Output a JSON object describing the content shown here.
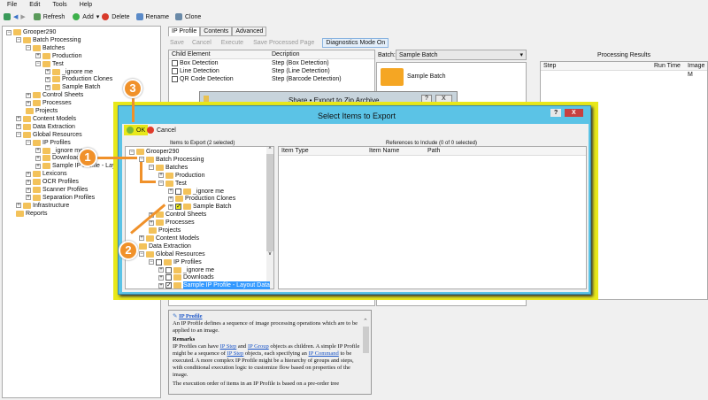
{
  "menu": [
    "File",
    "Edit",
    "Tools",
    "Help"
  ],
  "toolbar": {
    "refresh": "Refresh",
    "add": "Add",
    "delete": "Delete",
    "rename": "Rename",
    "clone": "Clone"
  },
  "tree": [
    [
      0,
      "Grooper290",
      "-"
    ],
    [
      1,
      "Batch Processing",
      "-"
    ],
    [
      2,
      "Batches",
      "-"
    ],
    [
      3,
      "Production",
      "+"
    ],
    [
      3,
      "Test",
      "-"
    ],
    [
      4,
      "_ignore me",
      "+"
    ],
    [
      4,
      "Production Clones",
      "+"
    ],
    [
      4,
      "Sample Batch",
      "+"
    ],
    [
      2,
      "Control Sheets",
      "+"
    ],
    [
      2,
      "Processes",
      "+"
    ],
    [
      2,
      "Projects",
      ""
    ],
    [
      1,
      "Content Models",
      "+"
    ],
    [
      1,
      "Data Extraction",
      "+"
    ],
    [
      1,
      "Global Resources",
      "-"
    ],
    [
      2,
      "IP Profiles",
      "-"
    ],
    [
      3,
      "_ignore me",
      "+"
    ],
    [
      3,
      "Downloads",
      "+"
    ],
    [
      3,
      "Sample IP Profile - Layout Data",
      "+"
    ],
    [
      2,
      "Lexicons",
      "+"
    ],
    [
      2,
      "OCR Profiles",
      "+"
    ],
    [
      2,
      "Scanner Profiles",
      "+"
    ],
    [
      2,
      "Separation Profiles",
      "+"
    ],
    [
      1,
      "Infrastructure",
      "+"
    ],
    [
      1,
      "Reports",
      ""
    ]
  ],
  "tabs": [
    "IP Profile",
    "Contents",
    "Advanced"
  ],
  "actions": {
    "save": "Save",
    "cancel": "Cancel",
    "execute": "Execute",
    "save_page": "Save Processed Page",
    "diag": "Diagnostics Mode On"
  },
  "grid": {
    "cols": [
      "Child Element",
      "Decription"
    ],
    "rows": [
      [
        "Box Detection",
        "Step (Box Detection)"
      ],
      [
        "Line Detection",
        "Step (Line Detection)"
      ],
      [
        "QR Code Detection",
        "Step (Barcode Detection)"
      ]
    ]
  },
  "batch": {
    "label": "Batch:",
    "value": "Sample Batch",
    "item": "Sample Batch"
  },
  "results": {
    "title": "Processing Results",
    "cols": [
      "Step",
      "Run Time",
      "Image M"
    ]
  },
  "help": {
    "title": "IP Profile",
    "p1": "An IP Profile defines a sequence of image processing operations which are to be applied to an image.",
    "remarks": "Remarks",
    "p2a": "IP Profiles can have ",
    "l1": "IP Step",
    "p2b": " and ",
    "l2": "IP Group",
    "p2c": " objects as children. A simple IP Profile might be a sequence of ",
    "l3": "IP Step",
    "p2d": " objects, each specifying an ",
    "l4": "IP Command",
    "p2e": " to be executed. A more complex IP Profile might be a hierarchy of groups and steps, with conditional execution logic to customize flow based on properties of the image.",
    "p3": "The execution order of items in an IP Profile is based on a pre-order tree"
  },
  "share": {
    "title": "Share • Export to Zip Archive",
    "help": "?",
    "close": "X"
  },
  "dialog": {
    "title": "Select Items to Export",
    "help": "?",
    "close": "X",
    "ok": "OK",
    "cancel": "Cancel",
    "left_title": "Items to Export (2 selected)",
    "right_title": "References to Include (0 of 0 selected)",
    "cols": [
      "Item Type",
      "Item Name",
      "Path"
    ],
    "tree": [
      [
        0,
        "Grooper290",
        "-",
        ""
      ],
      [
        1,
        "Batch Processing",
        "-",
        ""
      ],
      [
        2,
        "Batches",
        "-",
        ""
      ],
      [
        3,
        "Production",
        "+",
        ""
      ],
      [
        3,
        "Test",
        "-",
        ""
      ],
      [
        4,
        "_ignore me",
        "+",
        "no"
      ],
      [
        4,
        "Production Clones",
        "+",
        ""
      ],
      [
        4,
        "Sample Batch",
        "+",
        "yes"
      ],
      [
        2,
        "Control Sheets",
        "+",
        ""
      ],
      [
        2,
        "Processes",
        "+",
        ""
      ],
      [
        2,
        "Projects",
        "",
        ""
      ],
      [
        1,
        "Content Models",
        "+",
        ""
      ],
      [
        1,
        "Data Extraction",
        "",
        ""
      ],
      [
        1,
        "Global Resources",
        "-",
        ""
      ],
      [
        2,
        "IP Profiles",
        "-",
        "no"
      ],
      [
        3,
        "_ignore me",
        "+",
        "no"
      ],
      [
        3,
        "Downloads",
        "+",
        "no"
      ],
      [
        3,
        "Sample IP Profile - Layout Data",
        "+",
        "yes"
      ]
    ]
  },
  "callouts": [
    "1",
    "2",
    "3"
  ],
  "colors": {
    "highlight": "#e8e81a",
    "dialog_border": "#5bc3e6",
    "callout": "#f0912a"
  }
}
